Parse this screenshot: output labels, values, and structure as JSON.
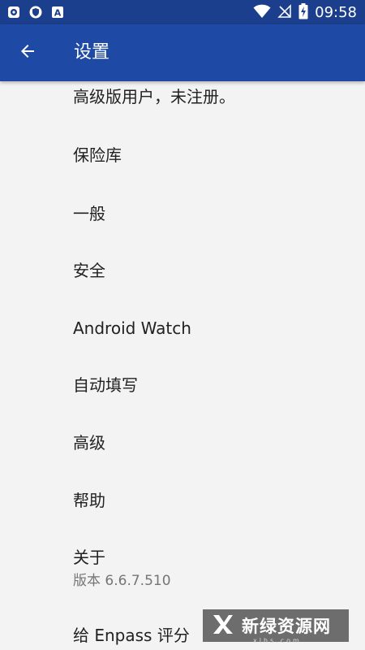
{
  "status_bar": {
    "time": "09:58",
    "notification_icons": [
      "enpass-notification-icon",
      "shield-notification-icon",
      "a-letter-notification-icon"
    ],
    "a_letter": "A",
    "system_icons": [
      "wifi-icon",
      "no-signal-icon",
      "battery-charging-icon"
    ],
    "background": "#1b3f8c"
  },
  "app_bar": {
    "title": "设置",
    "back_icon": "arrow-left-icon",
    "background": "#1e4aa5"
  },
  "settings": {
    "items": [
      {
        "label": "高级版用户，未注册。"
      },
      {
        "label": "保险库"
      },
      {
        "label": "一般"
      },
      {
        "label": "安全"
      },
      {
        "label": "Android Watch"
      },
      {
        "label": "自动填写"
      },
      {
        "label": "高级"
      },
      {
        "label": "帮助"
      },
      {
        "label": "关于",
        "subtitle": "版本 6.6.7.510"
      },
      {
        "label": "给 Enpass 评分"
      }
    ]
  },
  "watermark": {
    "text": "新绿资源网",
    "domain": "xlhs.com"
  }
}
